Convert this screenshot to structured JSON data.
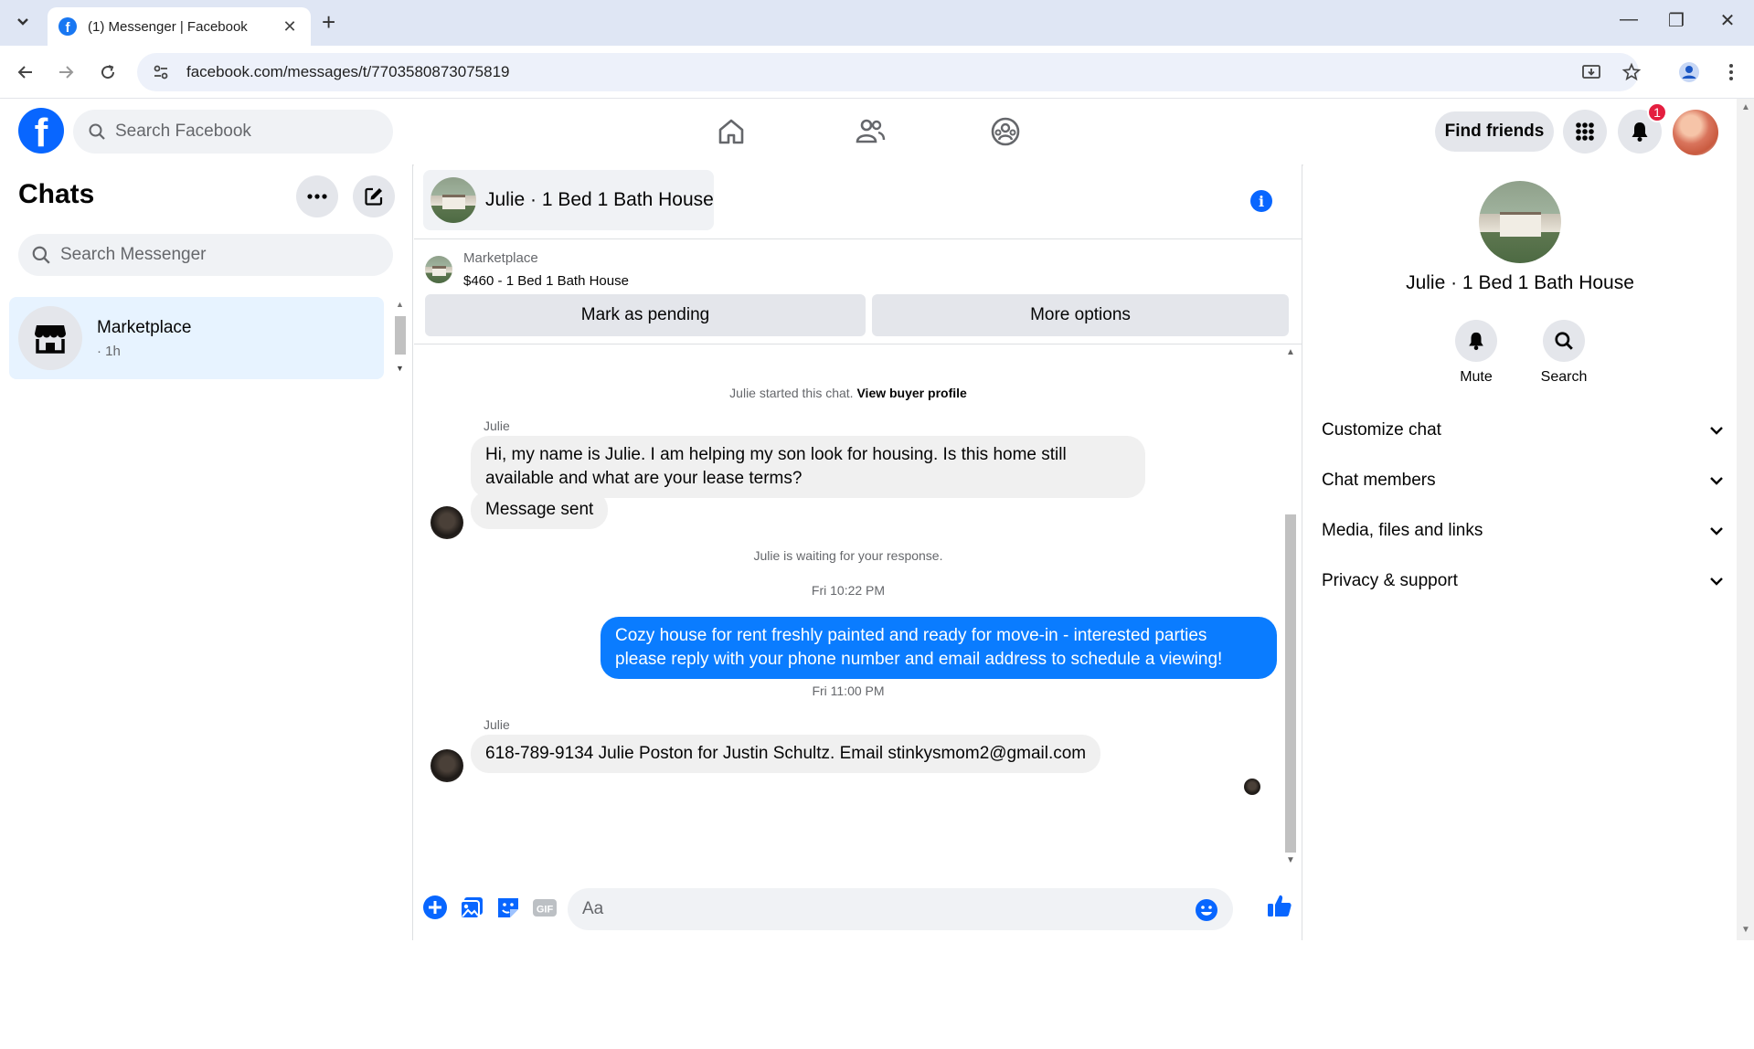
{
  "browser": {
    "tab_title": "(1) Messenger | Facebook",
    "url": "facebook.com/messages/t/7703580873075819"
  },
  "header": {
    "search_placeholder": "Search Facebook",
    "find_friends_label": "Find friends",
    "notification_count": "1"
  },
  "sidebar": {
    "title": "Chats",
    "search_placeholder": "Search Messenger",
    "chats": [
      {
        "name": "Marketplace",
        "time": "· 1h"
      }
    ]
  },
  "conversation": {
    "title": "Julie · 1 Bed 1 Bath House",
    "marketplace_label": "Marketplace",
    "listing": "$460 - 1 Bed 1 Bath House",
    "mark_pending_label": "Mark as pending",
    "more_options_label": "More options",
    "started_text": "Julie started this chat.",
    "view_profile_label": "View buyer profile",
    "sender_1": "Julie",
    "message_1": "Hi, my name is Julie. I am helping my son look for housing. Is this home still available and what are your lease terms?",
    "message_2": "Message sent",
    "waiting_text": "Julie is waiting for your response.",
    "timestamp_1": "Fri 10:22 PM",
    "message_3": "Cozy house for rent freshly painted and ready for move-in - interested parties please reply with your phone number and email address to schedule a viewing!",
    "timestamp_2": "Fri 11:00 PM",
    "sender_2": "Julie",
    "message_4": "618-789-9134 Julie Poston for Justin Schultz. Email stinkysmom2@gmail.com",
    "composer_placeholder": "Aa"
  },
  "info_panel": {
    "name": "Julie · 1 Bed 1 Bath House",
    "mute_label": "Mute",
    "search_label": "Search",
    "sections": [
      "Customize chat",
      "Chat members",
      "Media, files and links",
      "Privacy & support"
    ]
  },
  "colors": {
    "brand_blue": "#0866ff",
    "outgoing_bubble": "#0a7cff",
    "notification_red": "#e41e3f"
  }
}
